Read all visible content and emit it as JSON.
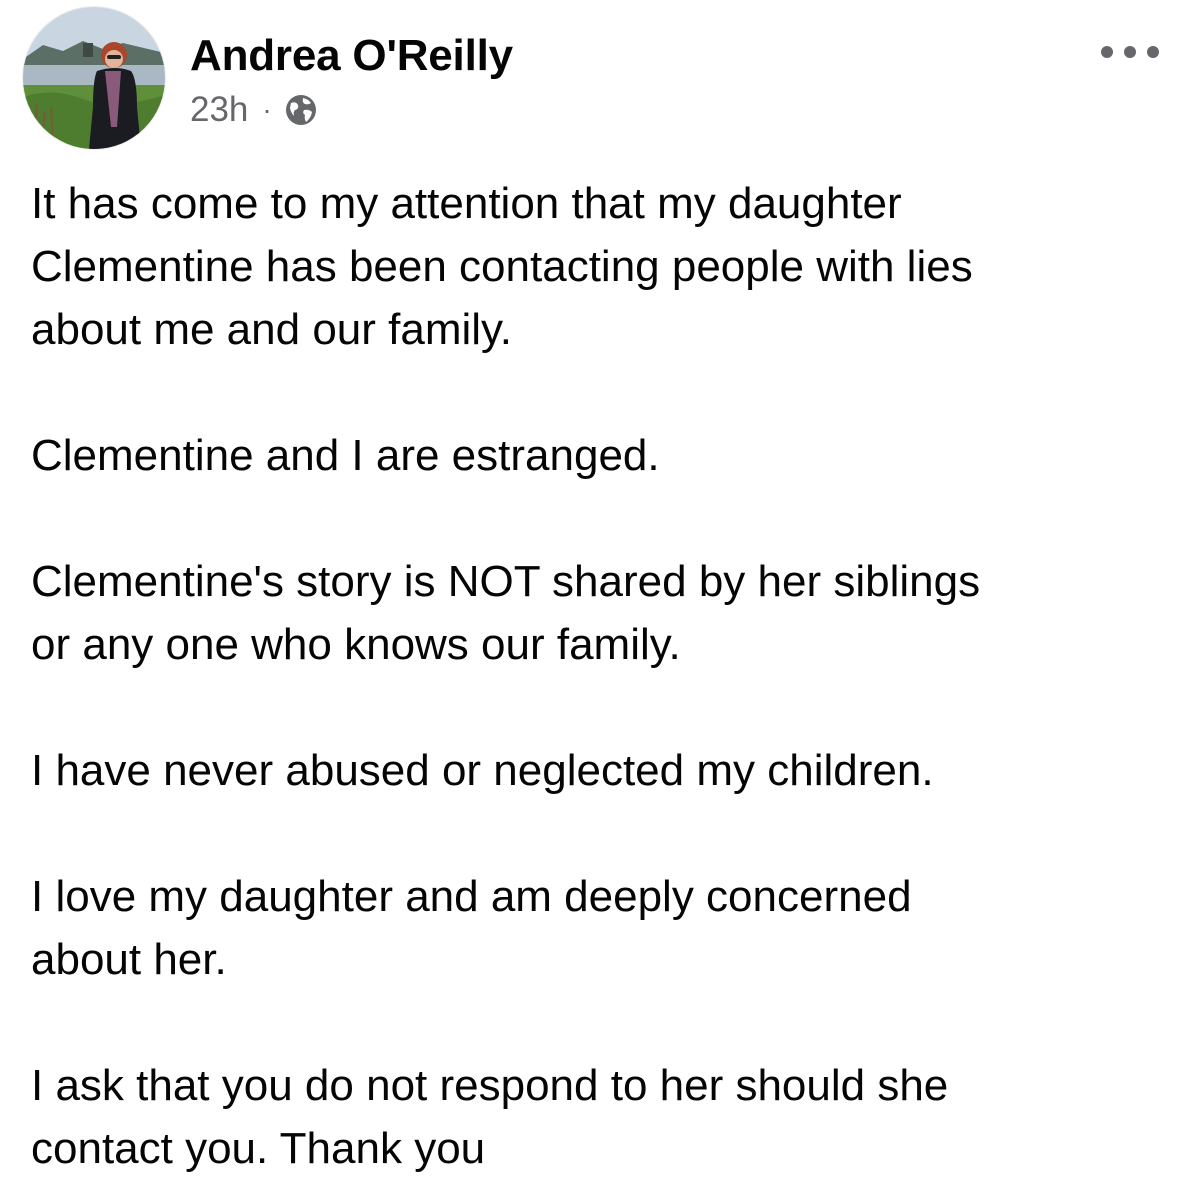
{
  "post": {
    "author": "Andrea O'Reilly",
    "timestamp": "23h",
    "separator": "·",
    "audience_icon": "globe-icon",
    "more_icon": "more-options-icon",
    "paragraphs": [
      "It has come to my attention that my daughter\nClementine has been contacting people with lies\nabout me and our family.",
      "Clementine and I are estranged.",
      "Clementine's story is NOT shared by her siblings\nor any one who knows our family.",
      "I have never abused or neglected my children.",
      "I love my daughter and am deeply concerned\nabout her.",
      "I ask that you do not respond to her should she\ncontact you. Thank you"
    ]
  },
  "colors": {
    "text": "#050505",
    "meta": "#65676b",
    "background": "#ffffff"
  }
}
